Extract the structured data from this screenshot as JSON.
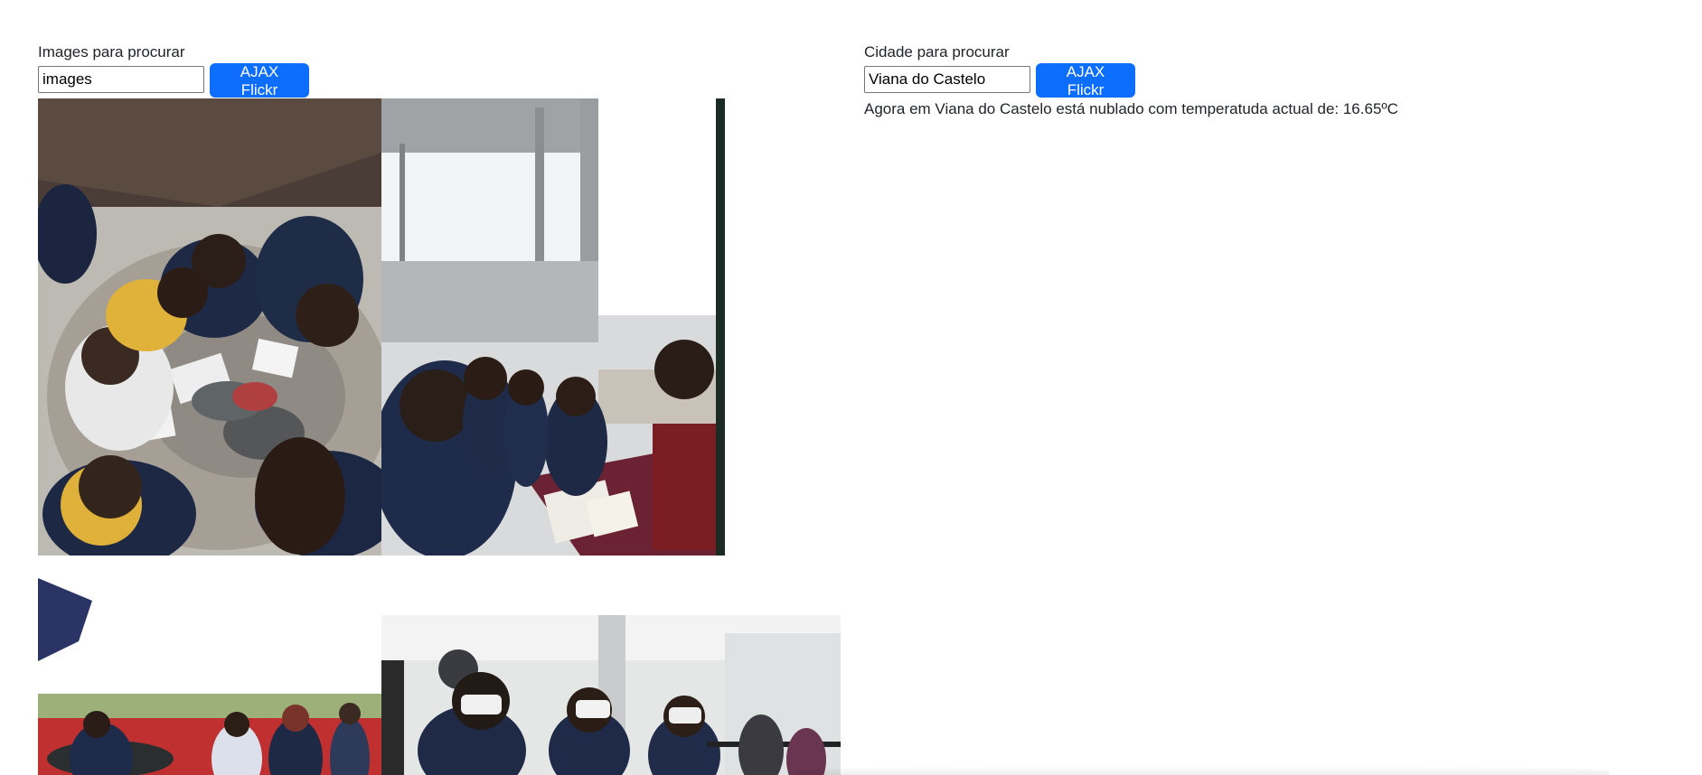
{
  "left_panel": {
    "label": "Images para procurar",
    "input_value": "images",
    "button_label": "AJAX Flickr"
  },
  "right_panel": {
    "label": "Cidade para procurar",
    "input_value": "Viana do Castelo",
    "button_label": "AJAX Flickr",
    "result_text": "Agora em Viana do Castelo está nublado com temperatuda actual de: 16.65ºC"
  },
  "gallery": {
    "photos": [
      {
        "description": "students-around-table"
      },
      {
        "description": "students-at-exhibit-stand"
      },
      {
        "description": "students-outdoor-terrace"
      },
      {
        "description": "students-with-vr-headsets"
      }
    ]
  },
  "colors": {
    "button": "#0d6efd",
    "text": "#212529"
  }
}
